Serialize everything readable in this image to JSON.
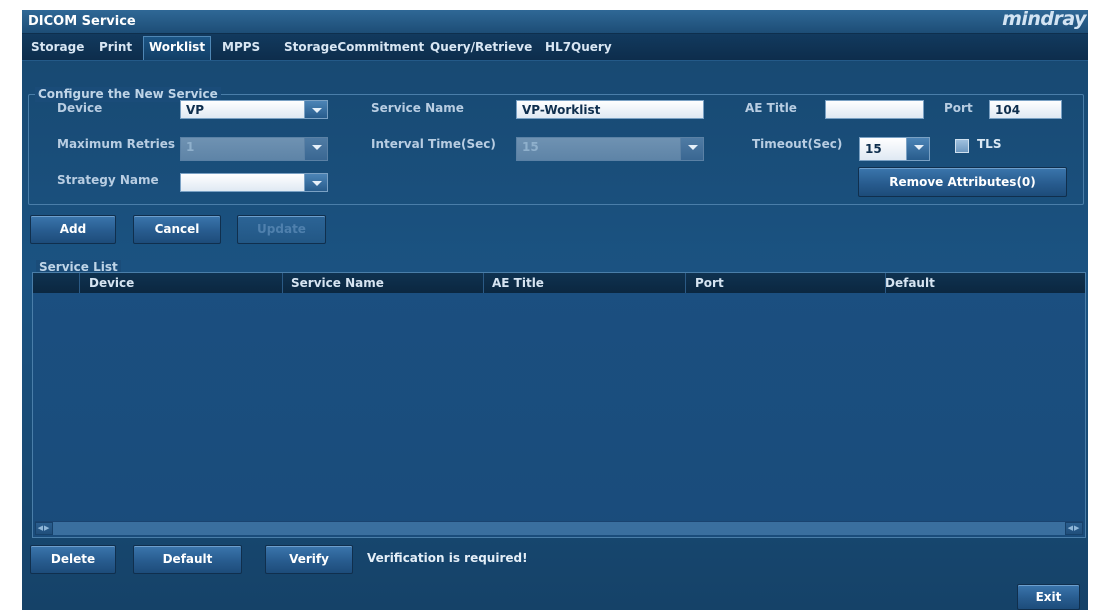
{
  "window": {
    "title": "DICOM Service",
    "brand": "mindray"
  },
  "tabs": [
    {
      "label": "Storage"
    },
    {
      "label": "Print"
    },
    {
      "label": "Worklist",
      "active": true
    },
    {
      "label": "MPPS"
    },
    {
      "label": "StorageCommitment"
    },
    {
      "label": "Query/Retrieve"
    },
    {
      "label": "HL7Query"
    }
  ],
  "config": {
    "legend": "Configure the New Service",
    "device": {
      "label": "Device",
      "value": "VP"
    },
    "service_name": {
      "label": "Service Name",
      "value": "VP-Worklist"
    },
    "ae_title": {
      "label": "AE Title",
      "value": ""
    },
    "port": {
      "label": "Port",
      "value": "104"
    },
    "max_retries": {
      "label": "Maximum Retries",
      "value": "1"
    },
    "interval": {
      "label": "Interval Time(Sec)",
      "value": "15"
    },
    "timeout": {
      "label": "Timeout(Sec)",
      "value": "15"
    },
    "tls": {
      "label": "TLS",
      "checked": false
    },
    "strategy": {
      "label": "Strategy Name",
      "value": ""
    },
    "remove_attr": "Remove Attributes(0)"
  },
  "actions": {
    "add": "Add",
    "cancel": "Cancel",
    "update": "Update"
  },
  "service_list": {
    "legend": "Service List",
    "columns": [
      "Device",
      "Service Name",
      "AE Title",
      "Port",
      "Default"
    ],
    "rows": []
  },
  "bottom": {
    "delete": "Delete",
    "default": "Default",
    "verify": "Verify",
    "status": "Verification is required!",
    "exit": "Exit"
  }
}
